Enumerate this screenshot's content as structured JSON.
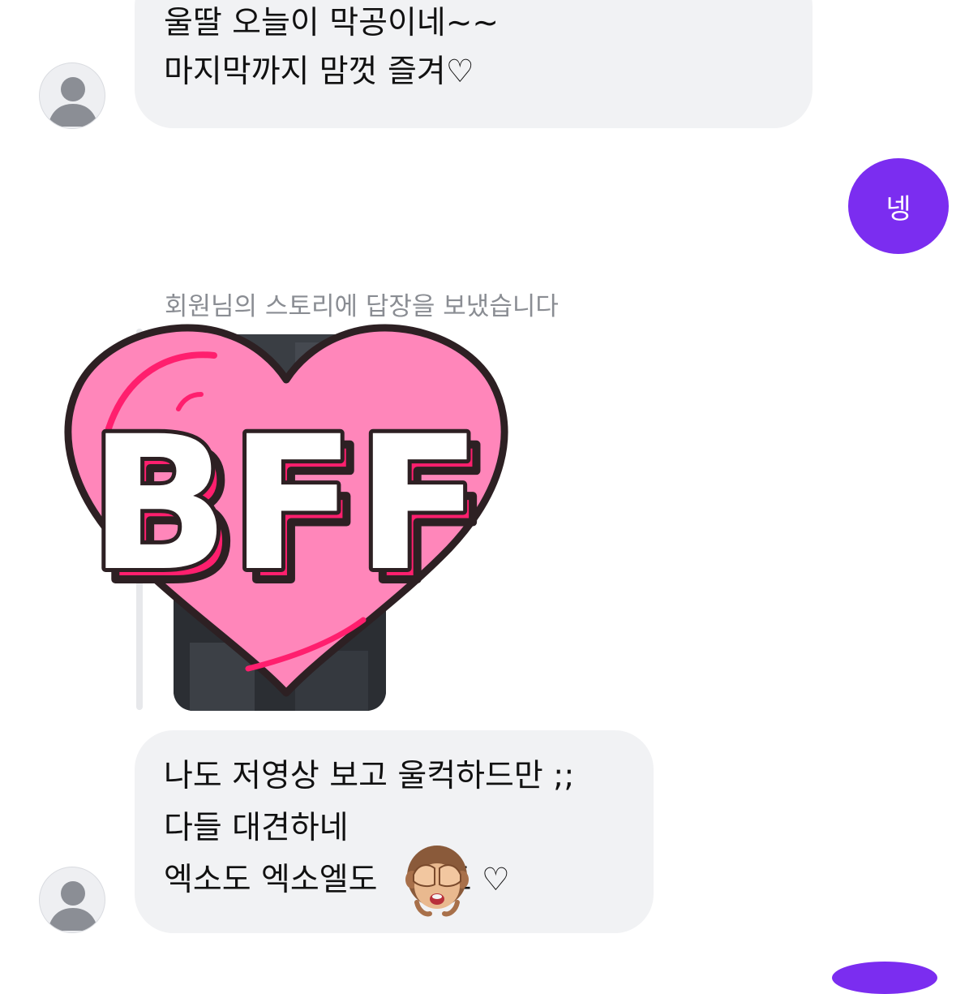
{
  "messages": [
    {
      "sender": "other",
      "lines": [
        "울딸 오늘이 막공이네~~",
        "마지막까지 맘껏 즐겨♡"
      ]
    },
    {
      "sender": "me",
      "text": "넹"
    },
    {
      "sender": "other",
      "type": "story-reply",
      "caption": "회원님의 스토리에 답장을 보냈습니다",
      "sticker_text": "BFF"
    },
    {
      "sender": "other",
      "lines": [
        "나도 저영상 보고 울컥하드만 ;;",
        "다들 대견하네",
        "엑소도 엑소엘도",
        "도 ♡"
      ],
      "emoji": "see-no-evil-monkey"
    }
  ],
  "colors": {
    "incoming_bubble": "#f1f2f4",
    "outgoing_bubble": "#7b2df0",
    "caption_text": "#8a8d93",
    "heart_pink": "#ff86ba",
    "heart_accent": "#ff1f6e"
  }
}
